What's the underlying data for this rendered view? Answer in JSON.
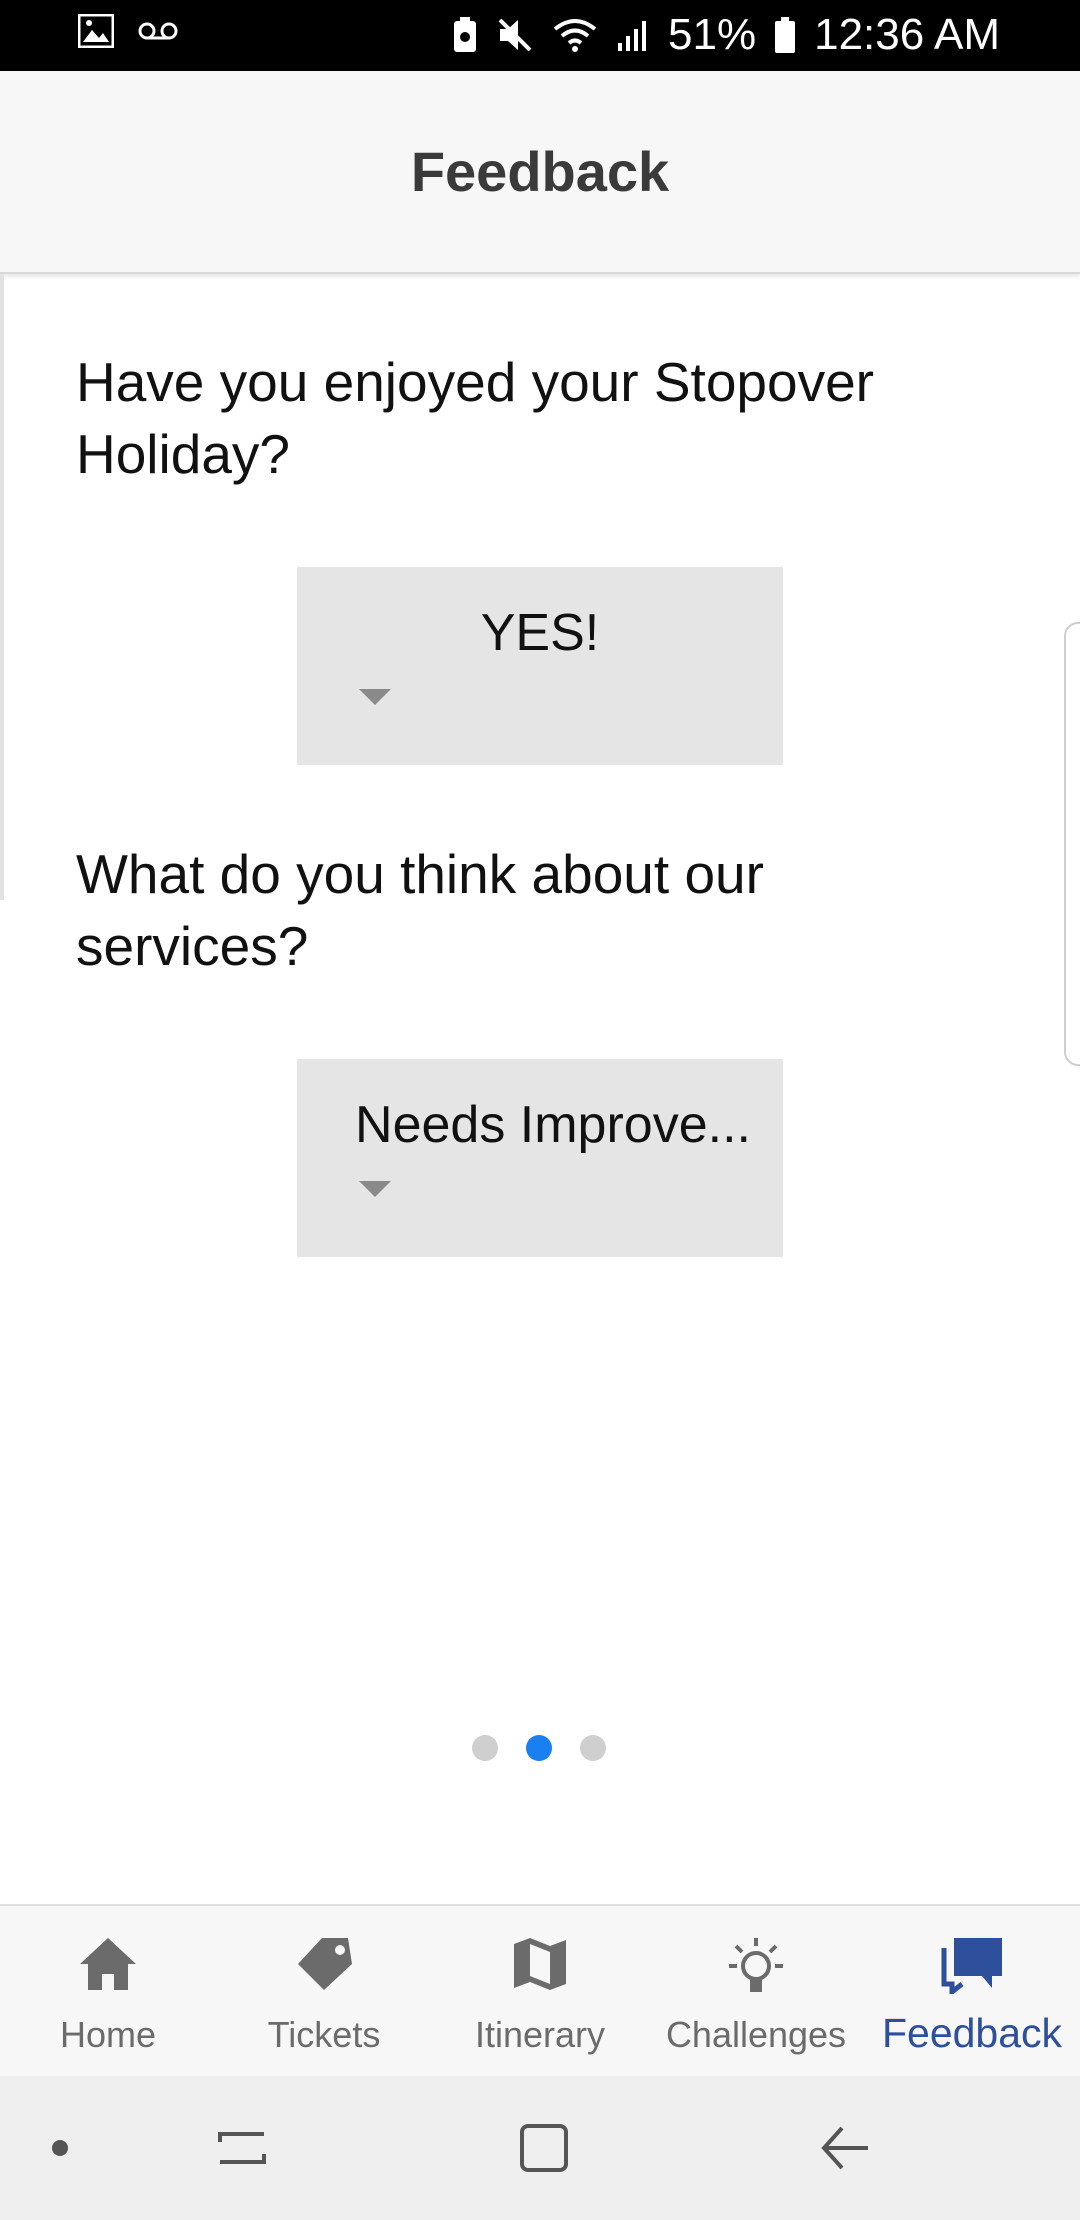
{
  "status_bar": {
    "battery": "51%",
    "time": "12:36 AM",
    "icons": [
      "image-icon",
      "voicemail-icon",
      "battery-saver-icon",
      "mute-icon",
      "wifi-icon",
      "signal-icon",
      "battery-icon"
    ]
  },
  "header": {
    "title": "Feedback"
  },
  "questions": [
    {
      "text": "Have you enjoyed your Stopover Holiday?",
      "selected": "YES!"
    },
    {
      "text": "What do you think about our services?",
      "selected": "Needs Improve..."
    }
  ],
  "pager": {
    "count": 3,
    "active_index": 1
  },
  "tabs": [
    {
      "label": "Home",
      "icon": "home-icon",
      "active": false
    },
    {
      "label": "Tickets",
      "icon": "tag-icon",
      "active": false
    },
    {
      "label": "Itinerary",
      "icon": "map-icon",
      "active": false
    },
    {
      "label": "Challenges",
      "icon": "lightbulb-icon",
      "active": false
    },
    {
      "label": "Feedback",
      "icon": "feedback-icon",
      "active": true
    }
  ],
  "colors": {
    "accent": "#1a7ff0",
    "active_tab": "#2d4f9c",
    "inactive_tab": "#6b6b6b",
    "picker_bg": "#e5e5e5"
  },
  "system_nav": [
    "recents-dot",
    "recent-apps-button",
    "home-button",
    "back-button"
  ]
}
